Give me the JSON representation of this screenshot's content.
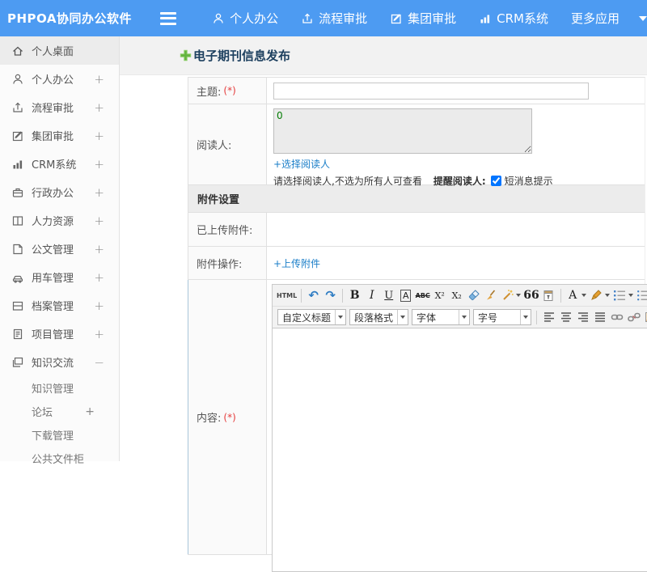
{
  "header": {
    "logo": "PHPOA协同办公软件",
    "nav": [
      {
        "label": "个人办公"
      },
      {
        "label": "流程审批"
      },
      {
        "label": "集团审批"
      },
      {
        "label": "CRM系统"
      },
      {
        "label": "更多应用"
      }
    ]
  },
  "sidebar": {
    "items": [
      {
        "label": "个人桌面",
        "toggle": ""
      },
      {
        "label": "个人办公",
        "toggle": "+"
      },
      {
        "label": "流程审批",
        "toggle": "+"
      },
      {
        "label": "集团审批",
        "toggle": "+"
      },
      {
        "label": "CRM系统",
        "toggle": "+"
      },
      {
        "label": "行政办公",
        "toggle": "+"
      },
      {
        "label": "人力资源",
        "toggle": "+"
      },
      {
        "label": "公文管理",
        "toggle": "+"
      },
      {
        "label": "用车管理",
        "toggle": "+"
      },
      {
        "label": "档案管理",
        "toggle": "+"
      },
      {
        "label": "项目管理",
        "toggle": "+"
      },
      {
        "label": "知识交流",
        "toggle": "−"
      }
    ],
    "subitems": [
      {
        "label": "知识管理",
        "toggle": ""
      },
      {
        "label": "论坛",
        "toggle": "+"
      },
      {
        "label": "下载管理",
        "toggle": ""
      },
      {
        "label": "公共文件柜",
        "toggle": ""
      }
    ]
  },
  "main": {
    "page_title": "电子期刊信息发布",
    "form": {
      "subject_label": "主题:",
      "subject_required": "(*)",
      "subject_value": "",
      "readers_label": "阅读人:",
      "readers_value": "0",
      "select_readers_link": "+选择阅读人",
      "readers_hint": "请选择阅读人,不选为所有人可查看",
      "remind_readers_label": "提醒阅读人:",
      "sms_label": "短消息提示",
      "sms_checked": true,
      "attachments_section": "附件设置",
      "uploaded_label": "已上传附件:",
      "operations_label": "附件操作:",
      "upload_link": "+上传附件",
      "content_label": "内容:",
      "content_required": "(*)"
    },
    "editor": {
      "buttons": {
        "html": "HTML",
        "undo": "↶",
        "redo": "↷",
        "bold": "B",
        "italic": "I",
        "underline": "U",
        "font_box": "A",
        "strike": "ABC",
        "superscript": "X²",
        "subscript": "X₂",
        "quote": "66",
        "font_color": "A"
      },
      "selects": {
        "heading": "自定义标题",
        "paragraph": "段落格式",
        "font": "字体",
        "size": "字号"
      }
    }
  },
  "colors": {
    "header_bg": "#4d9bf2",
    "link": "#1a7ec8",
    "required": "#e53c3c",
    "title": "#1c3f5e",
    "plus_green": "#62b33e",
    "reader_value": "#067d06"
  }
}
